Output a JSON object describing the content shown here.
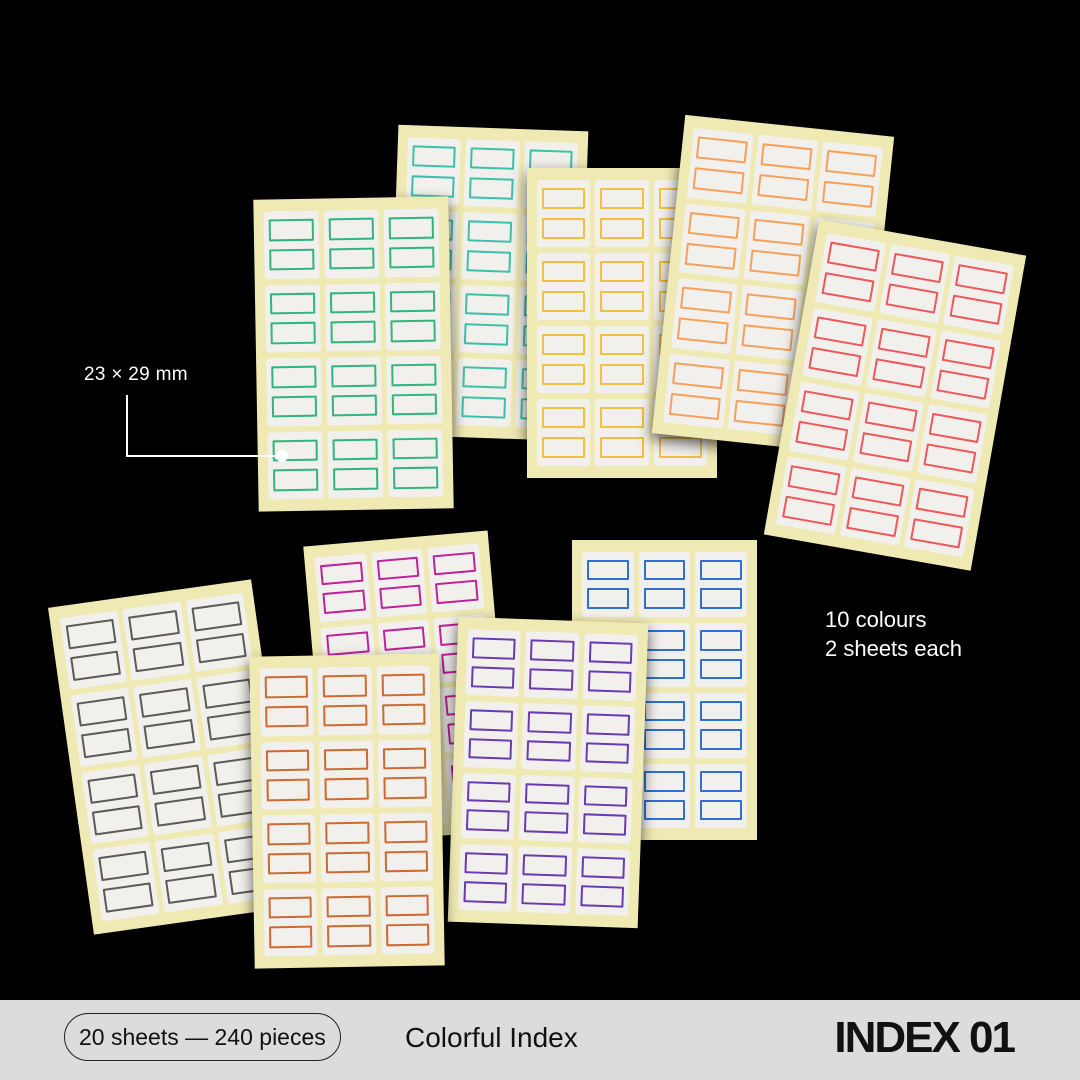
{
  "callout": {
    "size": "23 × 29 mm"
  },
  "info": {
    "line1": "10 colours",
    "line2": "2 sheets each"
  },
  "footer": {
    "count": "20 sheets — 240 pieces",
    "product_name": "Colorful Index",
    "code": "INDEX 01"
  },
  "colors": {
    "green": "#2fb57d",
    "teal": "#3cc0aa",
    "yellow": "#f0c040",
    "light-orange": "#f7a05a",
    "red": "#f0575a",
    "gray": "#5a5a5a",
    "magenta": "#c0229a",
    "brown": "#cc6a32",
    "purple": "#6a3ab0",
    "blue": "#2f6fd4"
  },
  "sheets": [
    {
      "name": "sheet-teal",
      "color": "teal"
    },
    {
      "name": "sheet-yellow",
      "color": "yellow"
    },
    {
      "name": "sheet-light-orange",
      "color": "light-orange"
    },
    {
      "name": "sheet-red",
      "color": "red"
    },
    {
      "name": "sheet-green",
      "color": "green"
    },
    {
      "name": "sheet-blue",
      "color": "blue"
    },
    {
      "name": "sheet-magenta",
      "color": "magenta"
    },
    {
      "name": "sheet-purple",
      "color": "purple"
    },
    {
      "name": "sheet-gray",
      "color": "gray"
    },
    {
      "name": "sheet-brown",
      "color": "brown"
    }
  ]
}
